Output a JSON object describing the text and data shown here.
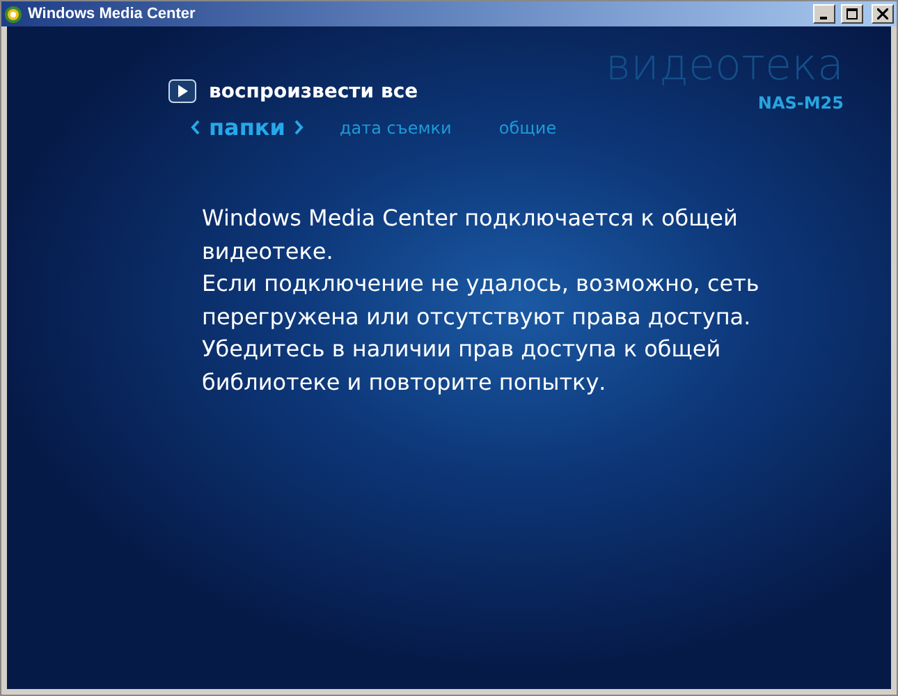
{
  "window": {
    "title": "Windows Media Center"
  },
  "header": {
    "title": "видеотека",
    "subtitle": "NAS-M25"
  },
  "play_all": {
    "label": "воспроизвести все"
  },
  "tabs": [
    {
      "label": "папки",
      "selected": true
    },
    {
      "label": "дата съемки",
      "selected": false
    },
    {
      "label": "общие",
      "selected": false
    }
  ],
  "message": [
    "Windows Media Center подключается к общей видеотеке.",
    "Если подключение не удалось, возможно, сеть перегружена или отсутствуют права доступа. Убедитесь в наличии прав доступа к общей библиотеке и повторите попытку."
  ]
}
